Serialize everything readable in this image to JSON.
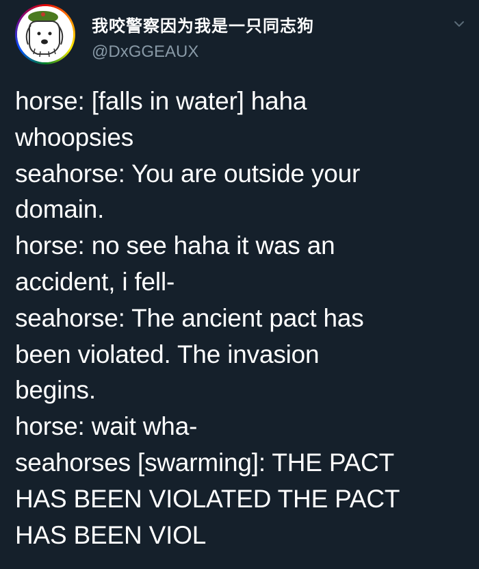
{
  "tweet": {
    "author": {
      "display_name": "我咬警察因为我是一只同志狗",
      "handle": "@DxGGEAUX",
      "avatar_icon": "dog-avatar-with-beret",
      "avatar_ring_colors": [
        "#e40303",
        "#ff8c00",
        "#ffed00",
        "#008026",
        "#004dff",
        "#750787"
      ]
    },
    "menu_icon": "chevron-down-icon",
    "text_lines": [
      "horse: [falls in water] haha",
      "whoopsies",
      "seahorse: You are outside your",
      "domain.",
      "horse: no see haha it was an",
      "accident, i fell-",
      "seahorse: The ancient pact has",
      "been violated. The invasion",
      "begins.",
      "horse: wait wha-",
      "seahorses [swarming]: THE PACT",
      "HAS BEEN VIOLATED THE PACT",
      "HAS BEEN VIOL"
    ]
  },
  "colors": {
    "background": "#15202b",
    "text": "#ffffff",
    "secondary_text": "#8899a6"
  }
}
